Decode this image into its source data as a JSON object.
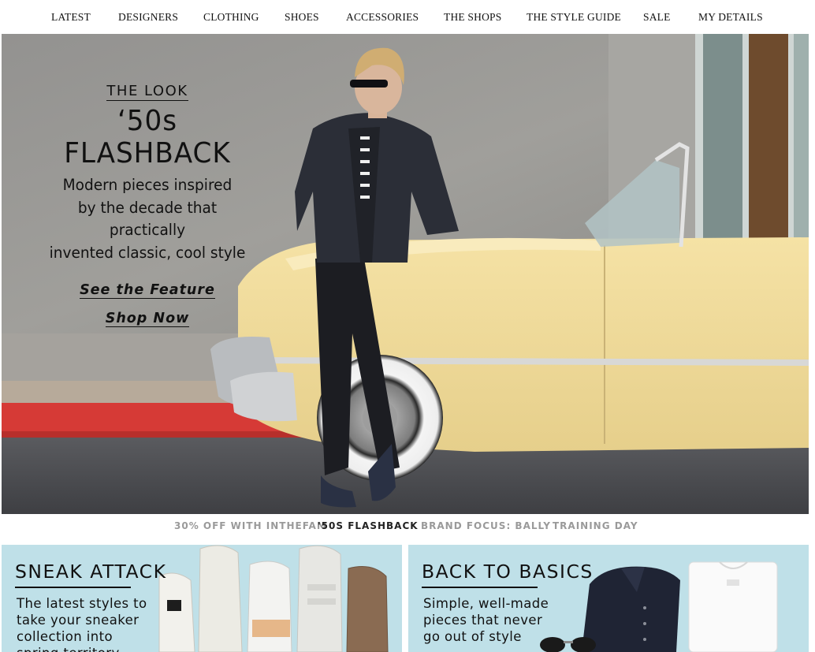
{
  "nav": {
    "items": [
      "LATEST",
      "DESIGNERS",
      "CLOTHING",
      "SHOES",
      "ACCESSORIES",
      "THE SHOPS",
      "THE STYLE GUIDE",
      "SALE",
      "MY DETAILS"
    ]
  },
  "hero": {
    "eyebrow": "THE LOOK",
    "title": "‘50s FLASHBACK",
    "subtitle": "Modern pieces inspired\nby the decade that practically\ninvented classic, cool style",
    "link_feature": "See the Feature",
    "link_shop": "Shop Now"
  },
  "subtabs": {
    "items": [
      "30% OFF WITH INTHEFAM",
      "'50S FLASHBACK",
      "BRAND FOCUS: BALLY",
      "TRAINING DAY"
    ],
    "active_index": 1
  },
  "tiles": [
    {
      "title": "SNEAK ATTACK",
      "description": "The latest styles to\ntake your sneaker\ncollection into\nspring territory"
    },
    {
      "title": "BACK TO BASICS",
      "description": "Simple, well-made\npieces that never\ngo out of style"
    }
  ],
  "colors": {
    "tile_background": "#bfe0e8",
    "car_yellow": "#f1dc9c",
    "curb_red": "#d63a36",
    "subtab_inactive": "#9a9a9a",
    "subtab_active": "#222222"
  }
}
